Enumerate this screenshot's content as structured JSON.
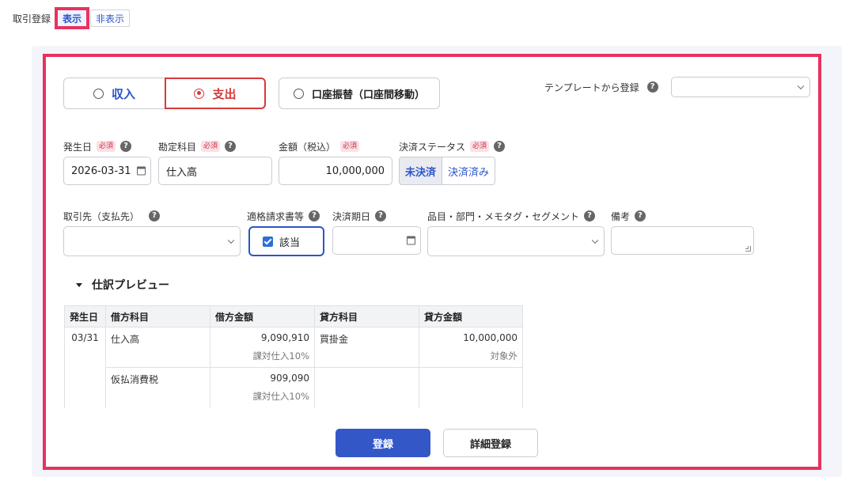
{
  "header": {
    "label": "取引登録",
    "show_label": "表示",
    "hide_label": "非表示"
  },
  "type_tabs": {
    "income": "収入",
    "expense": "支出",
    "transfer": "口座振替（口座間移動）",
    "selected": "expense"
  },
  "template": {
    "label": "テンプレートから登録",
    "value": ""
  },
  "required_badge": "必須",
  "help_icon_text": "?",
  "fields": {
    "date": {
      "label": "発生日",
      "value": "2026-03-31"
    },
    "account": {
      "label": "勘定科目",
      "value": "仕入高"
    },
    "amount": {
      "label": "金額（税込）",
      "value": "10,000,000"
    },
    "status": {
      "label": "決済ステータス",
      "options": [
        "未決済",
        "決済済み"
      ],
      "selected": "未決済"
    },
    "partner": {
      "label": "取引先（支払先）",
      "value": ""
    },
    "invoice": {
      "label": "適格請求書等",
      "checkbox_label": "該当",
      "checked": true
    },
    "due_date": {
      "label": "決済期日",
      "value": ""
    },
    "item": {
      "label": "品目・部門・メモタグ・セグメント",
      "value": ""
    },
    "remarks": {
      "label": "備考",
      "value": ""
    }
  },
  "preview": {
    "title": "仕訳プレビュー",
    "columns": [
      "発生日",
      "借方科目",
      "借方金額",
      "貸方科目",
      "貸方金額"
    ],
    "rows": [
      {
        "date": "03/31",
        "debit_account": "仕入高",
        "debit_amount": "9,090,910",
        "debit_tax": "課対仕入10%",
        "credit_account": "買掛金",
        "credit_amount": "10,000,000",
        "credit_tax": "対象外"
      },
      {
        "date": "",
        "debit_account": "仮払消費税",
        "debit_amount": "909,090",
        "debit_tax": "課対仕入10%",
        "credit_account": "",
        "credit_amount": "",
        "credit_tax": ""
      }
    ]
  },
  "actions": {
    "submit": "登録",
    "detail": "詳細登録"
  },
  "colors": {
    "accent": "#3457c8",
    "highlight": "#e8325e",
    "expense": "#d63a3a"
  }
}
